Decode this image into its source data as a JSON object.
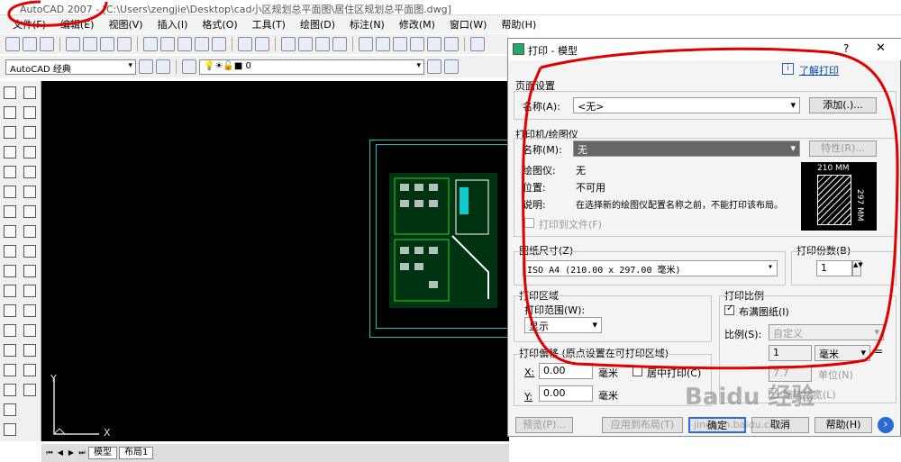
{
  "app": {
    "title": "AutoCAD 2007 - [C:\\Users\\zengjie\\Desktop\\cad小区规划总平面图\\居住区规划总平面图.dwg]"
  },
  "menu": [
    "文件(F)",
    "编辑(E)",
    "视图(V)",
    "插入(I)",
    "格式(O)",
    "工具(T)",
    "绘图(D)",
    "标注(N)",
    "修改(M)",
    "窗口(W)",
    "帮助(H)"
  ],
  "workspace": {
    "value": "AutoCAD 经典"
  },
  "layer": {
    "value": "0"
  },
  "canvas": {
    "axis_x": "X",
    "axis_y": "Y"
  },
  "layout_tabs": [
    "模型",
    "布局1"
  ],
  "dialog": {
    "title": "打印 - 模型",
    "help_btn": "?",
    "close_btn": "✕",
    "learn_link": "了解打印",
    "page_setup": {
      "group": "页面设置",
      "name_label": "名称(A):",
      "name_value": "<无>",
      "add_button": "添加(.)..."
    },
    "printer": {
      "group": "打印机/绘图仪",
      "name_label": "名称(M):",
      "name_value": "无",
      "props_button": "特性(R)...",
      "plotter_label": "绘图仪:",
      "plotter_value": "无",
      "location_label": "位置:",
      "location_value": "不可用",
      "desc_label": "说明:",
      "desc_value": "在选择新的绘图仪配置名称之前，不能打印该布局。",
      "print_to_file": "打印到文件(F)",
      "preview_w": "210 MM",
      "preview_h": "297 MM"
    },
    "paper": {
      "group": "图纸尺寸(Z)",
      "value": "ISO A4 (210.00 x 297.00 毫米)"
    },
    "copies": {
      "group": "打印份数(B)",
      "value": "1"
    },
    "area": {
      "group": "打印区域",
      "range_label": "打印范围(W):",
      "range_value": "显示"
    },
    "offset": {
      "group": "打印偏移 (原点设置在可打印区域)",
      "x_label": "X:",
      "x_value": "0.00",
      "y_label": "Y:",
      "y_value": "0.00",
      "unit": "毫米",
      "center": "居中打印(C)"
    },
    "scale": {
      "group": "打印比例",
      "fit": "布满图纸(I)",
      "scale_label": "比例(S):",
      "scale_value": "自定义",
      "num_value": "1",
      "unit_value": "毫米",
      "den_value": "7.7",
      "unit_label": "单位(N)",
      "lineweight": "缩放线宽(L)"
    },
    "buttons": {
      "preview": "预览(P)...",
      "apply": "应用到布局(T)",
      "ok": "确定",
      "cancel": "取消",
      "help": "帮助(H)",
      "more": "›"
    }
  },
  "watermark": {
    "main": "Baidu 经验",
    "sub": "jingyan.baidu.com"
  },
  "colors": {
    "annotation": "#e10000",
    "canvas": "#000000",
    "sheet_border": "#22bbbb"
  }
}
